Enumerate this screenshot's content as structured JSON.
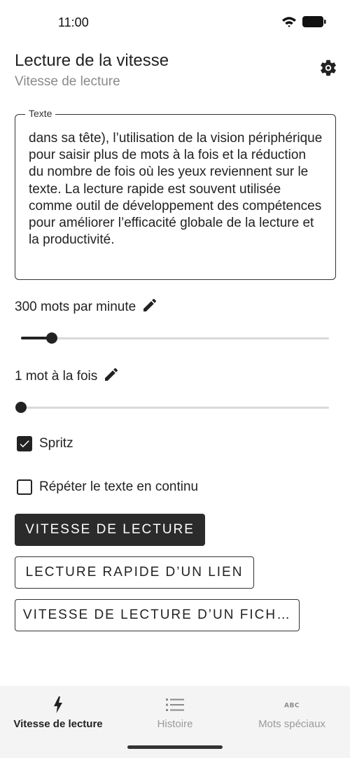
{
  "status_bar": {
    "time": "11:00"
  },
  "header": {
    "title": "Lecture de la vitesse",
    "subtitle": "Vitesse de lecture",
    "settings_icon": "gear-icon"
  },
  "text_field": {
    "label": "Texte",
    "value": "dans sa tête), l’utilisation de la vision périphérique pour saisir plus de mots à la fois et la réduction du nombre de fois où les yeux reviennent sur le texte. La lecture rapide est souvent utilisée comme outil de développement des compétences pour améliorer l’efficacité globale de la lecture et la productivité."
  },
  "speed": {
    "label": "300 mots par minute",
    "edit_icon": "pencil-icon",
    "slider_fraction": 0.1
  },
  "chunk": {
    "label": "1 mot à la fois",
    "edit_icon": "pencil-icon",
    "slider_fraction": 0.0
  },
  "options": [
    {
      "label": "Spritz",
      "checked": true
    },
    {
      "label": "Répéter le texte en continu",
      "checked": false
    }
  ],
  "buttons": {
    "read": "VITESSE DE LECTURE",
    "read_link": "LECTURE RAPIDE D’UN LIEN",
    "read_file": "VITESSE DE LECTURE D’UN FICH…"
  },
  "bottom_nav": {
    "items": [
      {
        "label": "Vitesse de lecture",
        "icon": "lightning-icon",
        "active": true
      },
      {
        "label": "Histoire",
        "icon": "list-icon",
        "active": false
      },
      {
        "label": "Mots spéciaux",
        "icon": "abc-icon",
        "active": false
      }
    ]
  },
  "colors": {
    "primary": "#2b2b2b",
    "muted": "#8a8a8a",
    "track": "#d9d9d9",
    "nav_background": "#f4f4f4"
  }
}
